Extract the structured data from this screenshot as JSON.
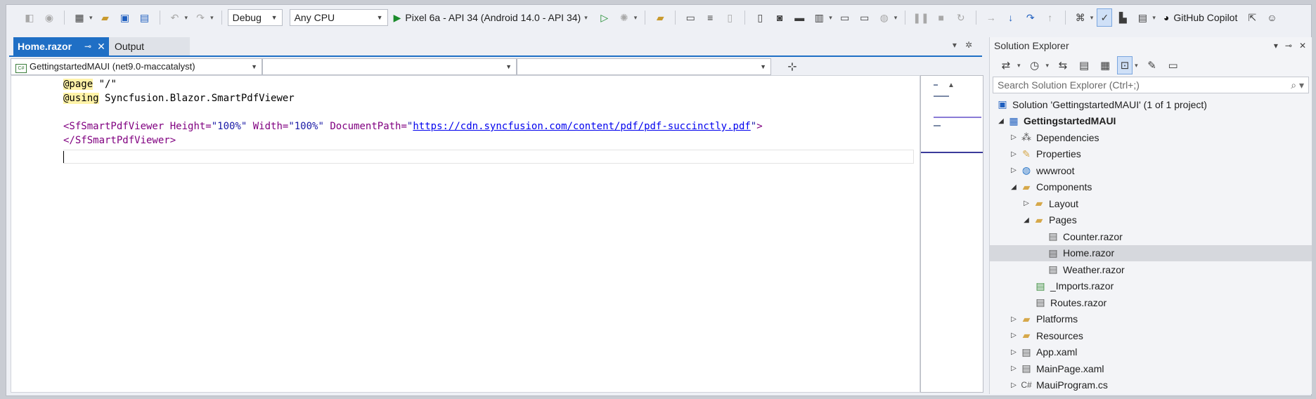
{
  "toolbar": {
    "config": "Debug",
    "platform": "Any CPU",
    "run_target": "Pixel 6a - API 34 (Android 14.0 - API 34)",
    "copilot": "GitHub Copilot"
  },
  "tabs": {
    "active": "Home.razor",
    "other": "Output"
  },
  "navbar": {
    "project": "GettingstartedMAUI (net9.0-maccatalyst)",
    "scope2": "",
    "scope3": ""
  },
  "code": {
    "line1_kw": "@page",
    "line1_rest": " \"/\"",
    "line2_kw": "@using",
    "line2_rest": " Syncfusion.Blazor.SmartPdfViewer",
    "line4_open": "<SfSmartPdfViewer",
    "line4_attr1": " Height=",
    "line4_val1": "\"100%\"",
    "line4_attr2": " Width=",
    "line4_val2": "\"100%\"",
    "line4_attr3": " DocumentPath=",
    "line4_q1": "\"",
    "line4_url": "https://cdn.syncfusion.com/content/pdf/pdf-succinctly.pdf",
    "line4_q2": "\"",
    "line4_close": ">",
    "line5": "</SfSmartPdfViewer>"
  },
  "solution_explorer": {
    "title": "Solution Explorer",
    "search_placeholder": "Search Solution Explorer (Ctrl+;)",
    "items": [
      {
        "label": "Solution 'GettingstartedMAUI' (1 of 1 project)"
      },
      {
        "label": "GettingstartedMAUI"
      },
      {
        "label": "Dependencies"
      },
      {
        "label": "Properties"
      },
      {
        "label": "wwwroot"
      },
      {
        "label": "Components"
      },
      {
        "label": "Layout"
      },
      {
        "label": "Pages"
      },
      {
        "label": "Counter.razor"
      },
      {
        "label": "Home.razor"
      },
      {
        "label": "Weather.razor"
      },
      {
        "label": "_Imports.razor"
      },
      {
        "label": "Routes.razor"
      },
      {
        "label": "Platforms"
      },
      {
        "label": "Resources"
      },
      {
        "label": "App.xaml"
      },
      {
        "label": "MainPage.xaml"
      },
      {
        "label": "MauiProgram.cs"
      }
    ]
  }
}
